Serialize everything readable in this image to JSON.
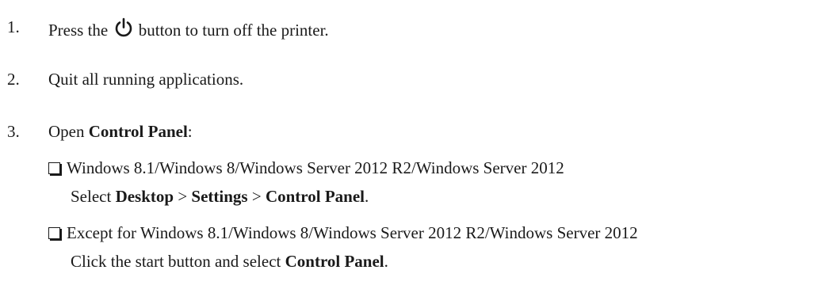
{
  "steps": [
    {
      "number": "1.",
      "before": "Press the",
      "icon": "power-icon",
      "after": " button to turn off the printer."
    },
    {
      "number": "2.",
      "text": "Quit all running applications."
    },
    {
      "number": "3.",
      "before": "Open ",
      "bold": "Control Panel",
      "after": ":"
    }
  ],
  "options": [
    {
      "heading": "Windows 8.1/Windows 8/Windows Server 2012 R2/Windows Server 2012",
      "instruction": {
        "before": "Select ",
        "b1": "Desktop",
        "sep1": " > ",
        "b2": "Settings",
        "sep2": " > ",
        "b3": "Control Panel",
        "end": "."
      }
    },
    {
      "heading": "Except for Windows 8.1/Windows 8/Windows Server 2012 R2/Windows Server 2012",
      "instruction": {
        "before": "Click the start button and select ",
        "b1": "Control Panel",
        "end": "."
      }
    }
  ]
}
